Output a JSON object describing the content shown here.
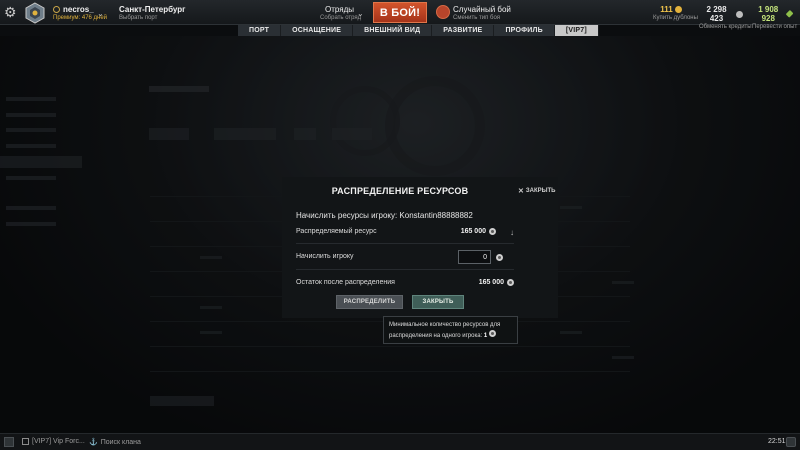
{
  "topbar": {
    "player_name": "necros_",
    "premium_text": "Премиум: 476 дней",
    "port_name": "Санкт-Петербург",
    "port_sub": "Выбрать порт",
    "squad_label": "Отряды",
    "squad_sub": "Собрать отряд",
    "battle_label": "В БОЙ!",
    "mode_label": "Случайный бой",
    "mode_sub": "Сменить тип боя",
    "gold_value": "111",
    "gold_label": "Купить дублоны",
    "credits_value": "2 298 423",
    "credits_label": "Обменять кредиты",
    "xp_value": "1 908 928",
    "xp_label": "Перевести опыт"
  },
  "nav_tabs": [
    "ПОРТ",
    "ОСНАЩЕНИЕ",
    "ВНЕШНИЙ ВИД",
    "РАЗВИТИЕ",
    "ПРОФИЛЬ",
    "[VIP7]"
  ],
  "active_tab": "[VIP7]",
  "modal": {
    "title": "РАСПРЕДЕЛЕНИЕ РЕСУРСОВ",
    "close_label": "ЗАКРЫТЬ",
    "subtitle": "Начислить ресурсы игроку: Konstantin88888882",
    "rows": [
      {
        "label": "Распределяемый ресурс",
        "value": "165 000"
      },
      {
        "label": "Начислить игроку",
        "value": "0"
      },
      {
        "label": "Остаток после распределения",
        "value": "165 000"
      }
    ],
    "distribute_button": "РАСПРЕДЕЛИТЬ",
    "close_button": "ЗАКРЫТЬ"
  },
  "tooltip": {
    "text": "Минимальное количество ресурсов для распределения на одного игрока:",
    "value": "1"
  },
  "bottombar": {
    "clan_chat": "[VIP7] Vip Forc...",
    "clan_search": "Поиск клана",
    "time": "22:51"
  }
}
